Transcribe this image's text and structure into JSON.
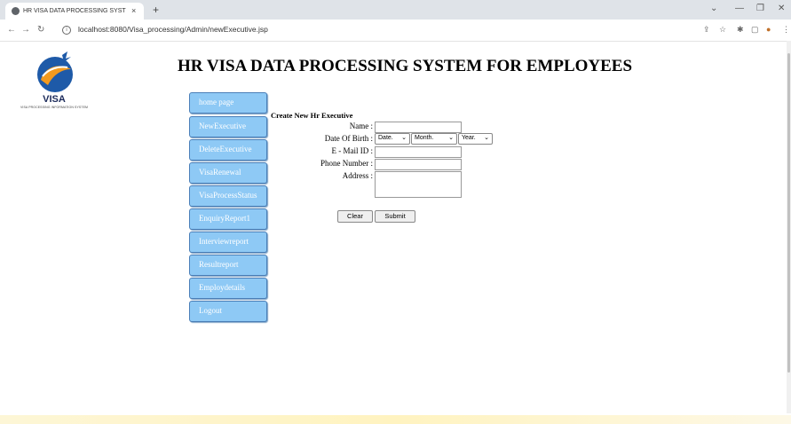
{
  "browser": {
    "tab_title": "HR VISA DATA PROCESSING SYST",
    "tab_close": "×",
    "new_tab": "+",
    "url": "localhost:8080/Visa_processing/Admin/newExecutive.jsp"
  },
  "logo": {
    "title": "VISA",
    "subtitle": "VISA PROCESSING INFORMATION SYSTEM"
  },
  "page_heading": "HR VISA DATA PROCESSING SYSTEM FOR EMPLOYEES",
  "menu": [
    "home page",
    "NewExecutive",
    "DeleteExecutive",
    "VisaRenewal",
    "VisaProcessStatus",
    "EnquiryReport1",
    "Interviewreport",
    "Resultreport",
    "Employdetails",
    "Logout"
  ],
  "form": {
    "title": "Create New Hr Executive",
    "name_label": "Name :",
    "dob_label": "Date Of Birth :",
    "email_label": "E - Mail ID :",
    "phone_label": "Phone Number :",
    "address_label": "Address :",
    "dob_date": "Date.",
    "dob_month": "Month.",
    "dob_year": "Year.",
    "clear_label": "Clear",
    "submit_label": "Submit"
  },
  "colors": {
    "menu_button": "#8ec9f5",
    "menu_border": "#4a7fb8"
  }
}
